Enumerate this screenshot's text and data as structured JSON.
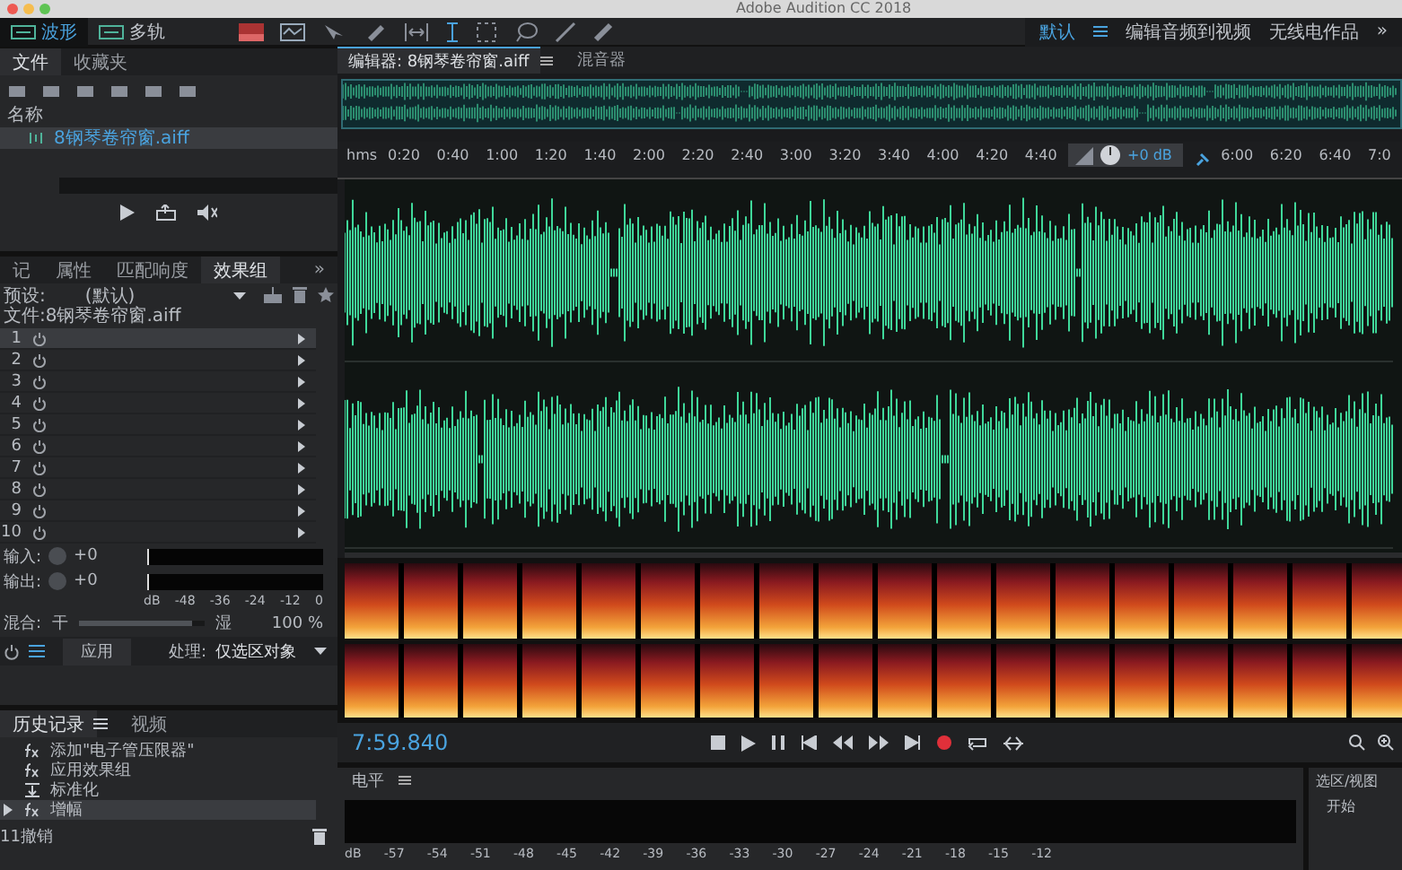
{
  "window": {
    "title": "Adobe Audition CC 2018"
  },
  "toolbar": {
    "modes": [
      {
        "label": "波形",
        "selected": true
      },
      {
        "label": "多轨",
        "selected": false
      }
    ]
  },
  "workspaces": [
    {
      "label": "默认",
      "selected": true
    },
    {
      "label": "编辑音频到视频",
      "selected": false
    },
    {
      "label": "无线电作品",
      "selected": false
    }
  ],
  "workspace_more": "»",
  "files_panel": {
    "tabs": [
      {
        "label": "文件",
        "selected": true
      },
      {
        "label": "收藏夹",
        "selected": false
      }
    ],
    "column": "名称",
    "files": [
      {
        "name": "8钢琴卷帘窗.aiff",
        "selected": true
      }
    ]
  },
  "effects_panel": {
    "tabs": [
      {
        "label": "记",
        "selected": false
      },
      {
        "label": "属性",
        "selected": false
      },
      {
        "label": "匹配响度",
        "selected": false
      },
      {
        "label": "效果组",
        "selected": true
      }
    ],
    "more": "»",
    "preset_label": "预设:",
    "preset": "(默认)",
    "file_label": "文件:8钢琴卷帘窗.aiff",
    "slots": [
      {
        "number": "1",
        "selected": true
      },
      {
        "number": "2",
        "selected": false
      },
      {
        "number": "3",
        "selected": false
      },
      {
        "number": "4",
        "selected": false
      },
      {
        "number": "5",
        "selected": false
      },
      {
        "number": "6",
        "selected": false
      },
      {
        "number": "7",
        "selected": false
      },
      {
        "number": "8",
        "selected": false
      },
      {
        "number": "9",
        "selected": false
      },
      {
        "number": "10",
        "selected": false
      }
    ],
    "input_label": "输入:",
    "input_value": "+0",
    "output_label": "输出:",
    "output_value": "+0",
    "meter_ticks": [
      "dB",
      "-48",
      "-36",
      "-24",
      "-12",
      "0"
    ],
    "mix_label": "混合:",
    "dry": "干",
    "wet": "湿",
    "mix": {
      "level": 0.9
    },
    "mix_value": "100 %",
    "apply": "应用",
    "process_label": "处理:",
    "process": "仅选区对象"
  },
  "history_panel": {
    "tabs": [
      {
        "label": "历史记录",
        "selected": true
      },
      {
        "label": "视频",
        "selected": false
      }
    ],
    "items": [
      {
        "kind": "effect",
        "label": "添加\"电子管压限器\"",
        "selected": false
      },
      {
        "kind": "effect",
        "label": "应用效果组",
        "selected": false
      },
      {
        "kind": "normalize",
        "label": "标准化",
        "selected": false
      },
      {
        "kind": "effect",
        "label": "增幅",
        "selected": true
      }
    ],
    "undo_count": "11撤销"
  },
  "editor": {
    "tabs": [
      {
        "label": "编辑器: 8钢琴卷帘窗.aiff",
        "selected": true
      },
      {
        "label": "混音器",
        "selected": false
      }
    ],
    "ruler": [
      "0:20",
      "0:40",
      "1:00",
      "1:20",
      "1:40",
      "2:00",
      "2:20",
      "2:40",
      "3:00",
      "3:20",
      "3:40",
      "4:00",
      "4:20",
      "4:40",
      "6:00",
      "6:20",
      "6:40",
      "7:0"
    ],
    "ruler_unit": "hms",
    "gain": "+0 dB",
    "time": "7:59.840"
  },
  "levels_panel": {
    "title": "电平",
    "ticks": [
      "dB",
      "-57",
      "-54",
      "-51",
      "-48",
      "-45",
      "-42",
      "-39",
      "-36",
      "-33",
      "-30",
      "-27",
      "-24",
      "-21",
      "-18",
      "-15",
      "-12"
    ]
  },
  "selection_panel": {
    "title": "选区/视图",
    "label": "开始"
  }
}
